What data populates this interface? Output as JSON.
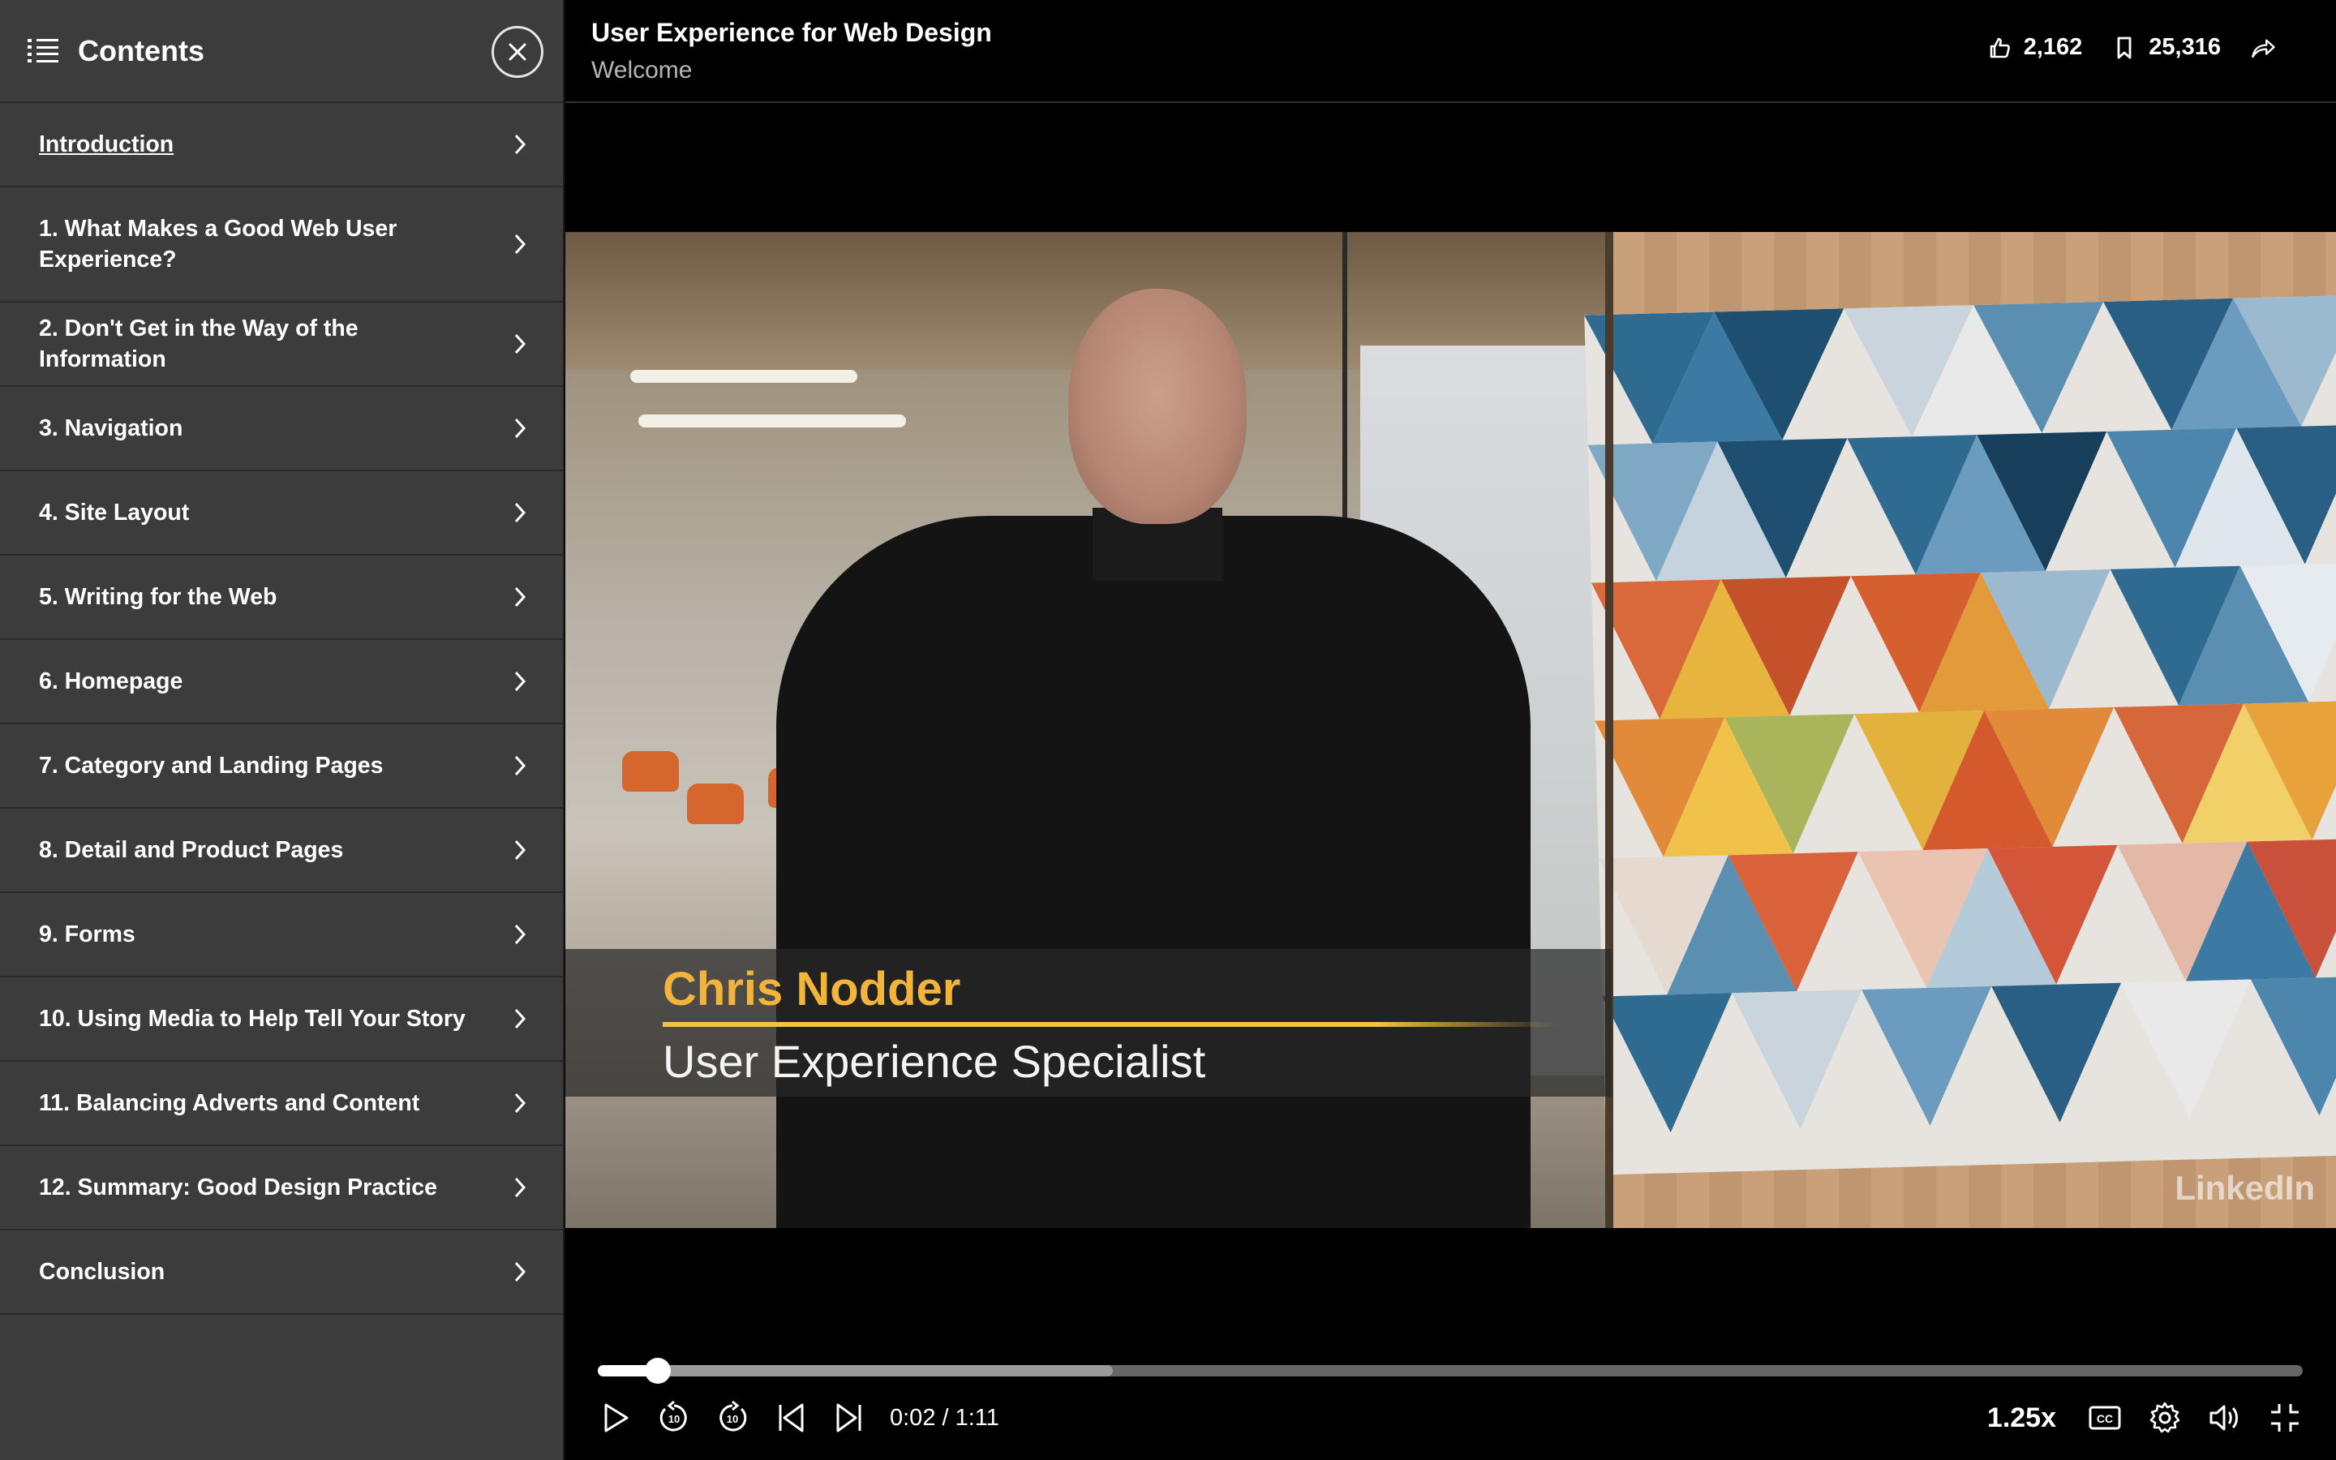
{
  "sidebar": {
    "title": "Contents",
    "items": [
      {
        "label": "Introduction"
      },
      {
        "label": "1. What Makes a Good Web User Experience?"
      },
      {
        "label": "2. Don't Get in the Way of the Information"
      },
      {
        "label": "3. Navigation"
      },
      {
        "label": "4. Site Layout"
      },
      {
        "label": "5. Writing for the Web"
      },
      {
        "label": "6. Homepage"
      },
      {
        "label": "7. Category and Landing Pages"
      },
      {
        "label": "8. Detail and Product Pages"
      },
      {
        "label": "9. Forms"
      },
      {
        "label": "10. Using Media to Help Tell Your Story"
      },
      {
        "label": "11. Balancing Adverts and Content"
      },
      {
        "label": "12. Summary: Good Design Practice"
      },
      {
        "label": "Conclusion"
      }
    ]
  },
  "header": {
    "course_title": "User Experience for Web Design",
    "chapter_title": "Welcome",
    "likes": "2,162",
    "saves": "25,316"
  },
  "video": {
    "lower_third_name": "Chris Nodder",
    "lower_third_role": "User Experience Specialist",
    "watermark": "LinkedIn"
  },
  "player": {
    "time": "0:02 / 1:11",
    "played_fraction": 0.035,
    "buffered_fraction": 0.302,
    "speed": "1.25x",
    "accent": "#f5c243"
  }
}
